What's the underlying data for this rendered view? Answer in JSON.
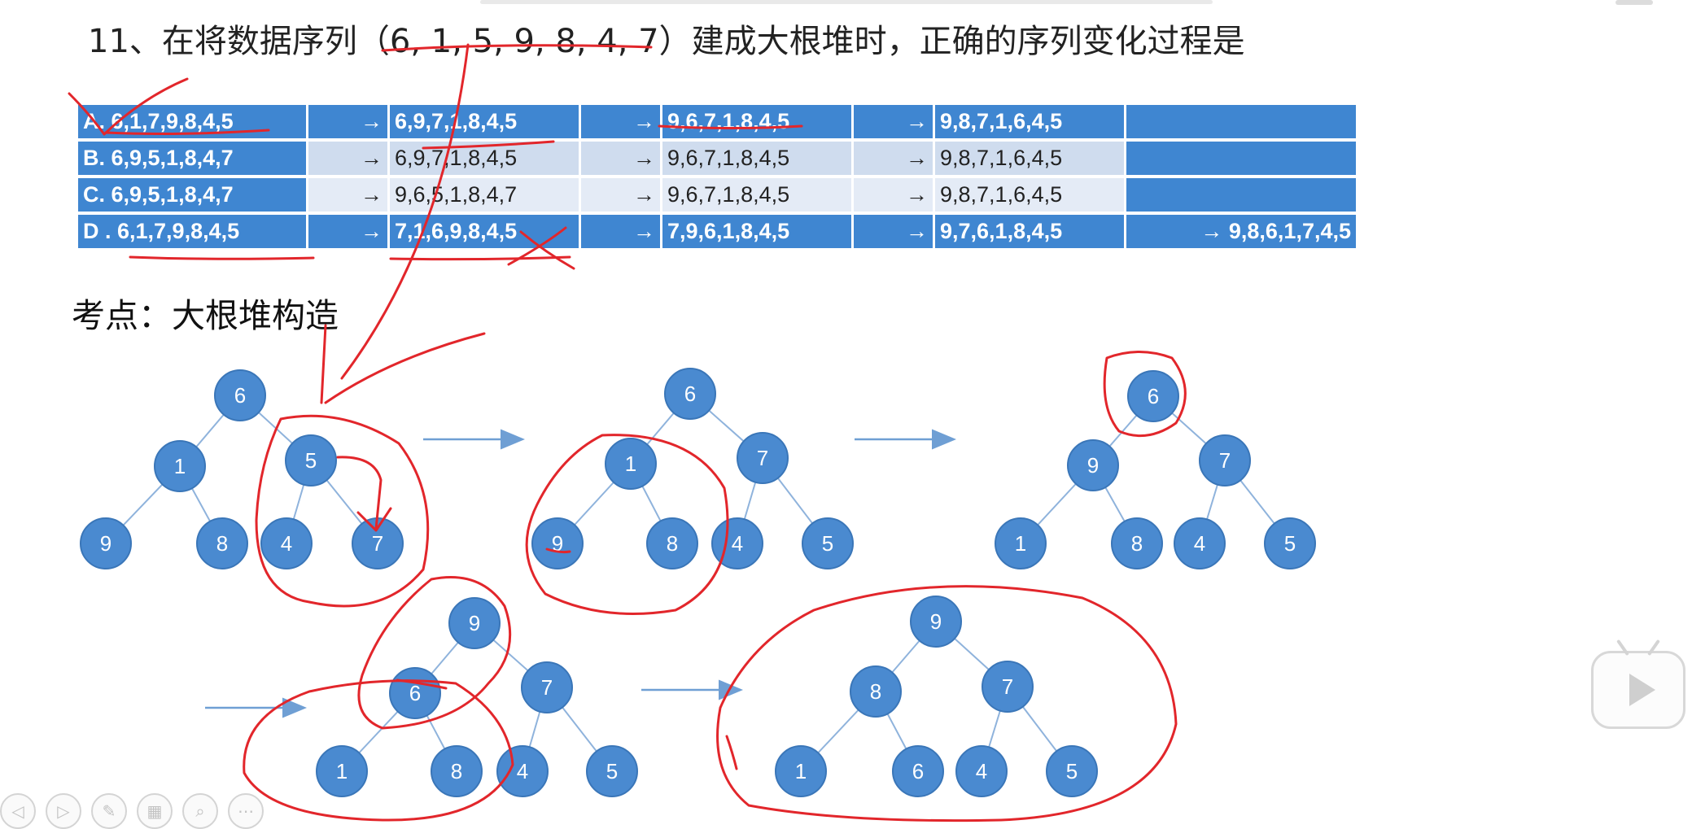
{
  "question": "11、在将数据序列（6, 1, 5, 9, 8, 4, 7）建成大根堆时，正确的序列变化过程是",
  "options": [
    {
      "label": "A. 6,1,7,9,8,4,5",
      "steps": [
        "6,9,7,1,8,4,5",
        "9,6,7,1,8,4,5",
        "9,8,7,1,6,4,5"
      ],
      "last": ""
    },
    {
      "label": "B. 6,9,5,1,8,4,7",
      "steps": [
        "6,9,7,1,8,4,5",
        "9,6,7,1,8,4,5",
        "9,8,7,1,6,4,5"
      ],
      "last": ""
    },
    {
      "label": "C. 6,9,5,1,8,4,7",
      "steps": [
        "9,6,5,1,8,4,7",
        "9,6,7,1,8,4,5",
        "9,8,7,1,6,4,5"
      ],
      "last": ""
    },
    {
      "label": "D . 6,1,7,9,8,4,5",
      "steps": [
        "7,1,6,9,8,4,5",
        "7,9,6,1,8,4,5",
        "9,7,6,1,8,4,5"
      ],
      "last": "→ 9,8,6,1,7,4,5"
    }
  ],
  "arrow_glyph": "→",
  "section_title": "考点：大根堆构造",
  "trees": [
    {
      "nodes": [
        "6",
        "1",
        "5",
        "9",
        "8",
        "4",
        "7"
      ]
    },
    {
      "nodes": [
        "6",
        "1",
        "7",
        "9",
        "8",
        "4",
        "5"
      ]
    },
    {
      "nodes": [
        "6",
        "9",
        "7",
        "1",
        "8",
        "4",
        "5"
      ]
    },
    {
      "nodes": [
        "9",
        "6",
        "7",
        "1",
        "8",
        "4",
        "5"
      ]
    },
    {
      "nodes": [
        "9",
        "8",
        "7",
        "1",
        "6",
        "4",
        "5"
      ]
    }
  ],
  "colors": {
    "node_fill": "#4a8ad0",
    "node_stroke": "#3a76b8",
    "edge": "#8fb3dc",
    "flow_arrow": "#6f9fd4",
    "annotation": "#e2262b",
    "table_header": "#3f86d1"
  },
  "toolbar_icons": [
    "prev-icon",
    "next-icon",
    "pen-icon",
    "grid-icon",
    "zoom-icon",
    "more-icon"
  ],
  "toolbar_glyphs": [
    "◁",
    "▷",
    "✎",
    "▦",
    "⌕",
    "⋯"
  ]
}
